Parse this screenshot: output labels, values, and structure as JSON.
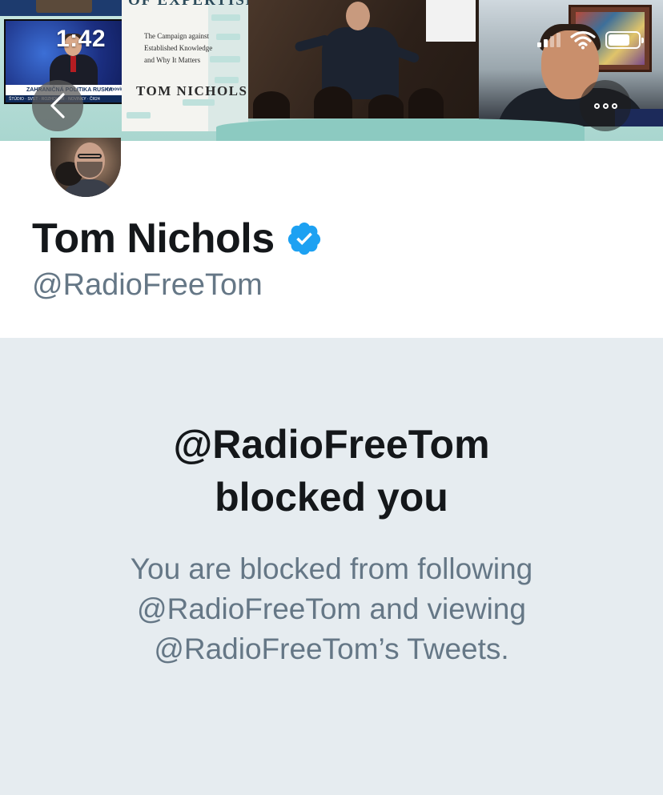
{
  "status_bar": {
    "time": "1:42"
  },
  "banner": {
    "book_title": "OF EXPERTISE",
    "book_subtitle": "The Campaign against Established Knowledge and Why It Matters",
    "book_author": "TOM NICHOLS",
    "tv_caption": "ZAHRANIČNÁ POLITIKA RUSKA",
    "tv_ticker": "ŠTÚDIO · SVET · ROZHOVOR · NOVINKY · ČR24",
    "tv_logo": "tvnoviny"
  },
  "profile": {
    "display_name": "Tom Nichols",
    "handle": "@RadioFreeTom",
    "verified": true
  },
  "blocked": {
    "title_line1": "@RadioFreeTom",
    "title_line2": "blocked you",
    "body_line1": "You are blocked from following",
    "body_line2": "@RadioFreeTom and viewing",
    "body_line3": "@RadioFreeTom’s Tweets."
  },
  "colors": {
    "text_primary": "#14171a",
    "text_secondary": "#657786",
    "verified_blue": "#1da1f2",
    "blocked_background": "#e6ecf0"
  },
  "icons": [
    "back-arrow-icon",
    "more-options-icon",
    "verified-badge-icon",
    "wifi-icon",
    "battery-icon",
    "signal-icon"
  ]
}
